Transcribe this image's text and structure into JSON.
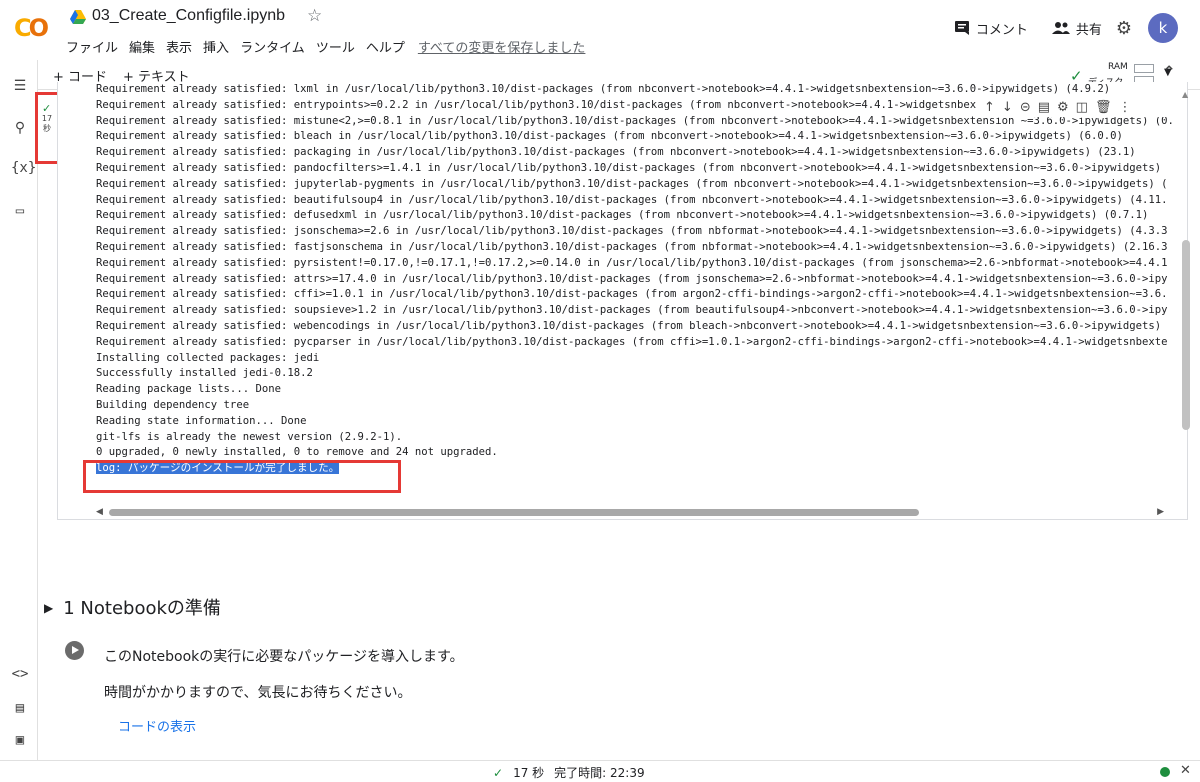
{
  "app": {
    "logo_text": "CO",
    "title": "03_Create_Configfile.ipynb"
  },
  "menu": [
    "ファイル",
    "編集",
    "表示",
    "挿入",
    "ランタイム",
    "ツール",
    "ヘルプ"
  ],
  "saved_status": "すべての変更を保存しました",
  "header": {
    "comment": "コメント",
    "share": "共有",
    "avatar": "k"
  },
  "toolbar": {
    "add_code": "+ コード",
    "add_text": "+ テキスト",
    "ram": "RAM",
    "disk": "ディスク"
  },
  "cell": {
    "exec_time": "17\n秒",
    "output_lines": [
      "Requirement already satisfied: lxml in /usr/local/lib/python3.10/dist-packages (from nbconvert->notebook>=4.4.1->widgetsnbextension~=3.6.0->ipywidgets) (4.9.2)",
      "Requirement already satisfied: entrypoints>=0.2.2 in /usr/local/lib/python3.10/dist-packages (from nbconvert->notebook>=4.4.1->widgetsnbex",
      "Requirement already satisfied: mistune<2,>=0.8.1 in /usr/local/lib/python3.10/dist-packages (from nbconvert->notebook>=4.4.1->widgetsnbextension ~=3.6.0->ipywidgets) (0.",
      "Requirement already satisfied: bleach in /usr/local/lib/python3.10/dist-packages (from nbconvert->notebook>=4.4.1->widgetsnbextension~=3.6.0->ipywidgets) (6.0.0)",
      "Requirement already satisfied: packaging in /usr/local/lib/python3.10/dist-packages (from nbconvert->notebook>=4.4.1->widgetsnbextension~=3.6.0->ipywidgets) (23.1)",
      "Requirement already satisfied: pandocfilters>=1.4.1 in /usr/local/lib/python3.10/dist-packages (from nbconvert->notebook>=4.4.1->widgetsnbextension~=3.6.0->ipywidgets)",
      "Requirement already satisfied: jupyterlab-pygments in /usr/local/lib/python3.10/dist-packages (from nbconvert->notebook>=4.4.1->widgetsnbextension~=3.6.0->ipywidgets) (",
      "Requirement already satisfied: beautifulsoup4 in /usr/local/lib/python3.10/dist-packages (from nbconvert->notebook>=4.4.1->widgetsnbextension~=3.6.0->ipywidgets) (4.11.",
      "Requirement already satisfied: defusedxml in /usr/local/lib/python3.10/dist-packages (from nbconvert->notebook>=4.4.1->widgetsnbextension~=3.6.0->ipywidgets) (0.7.1)",
      "Requirement already satisfied: jsonschema>=2.6 in /usr/local/lib/python3.10/dist-packages (from nbformat->notebook>=4.4.1->widgetsnbextension~=3.6.0->ipywidgets) (4.3.3",
      "Requirement already satisfied: fastjsonschema in /usr/local/lib/python3.10/dist-packages (from nbformat->notebook>=4.4.1->widgetsnbextension~=3.6.0->ipywidgets) (2.16.3",
      "Requirement already satisfied: pyrsistent!=0.17.0,!=0.17.1,!=0.17.2,>=0.14.0 in /usr/local/lib/python3.10/dist-packages (from jsonschema>=2.6->nbformat->notebook>=4.4.1",
      "Requirement already satisfied: attrs>=17.4.0 in /usr/local/lib/python3.10/dist-packages (from jsonschema>=2.6->nbformat->notebook>=4.4.1->widgetsnbextension~=3.6.0->ipy",
      "Requirement already satisfied: cffi>=1.0.1 in /usr/local/lib/python3.10/dist-packages (from argon2-cffi-bindings->argon2-cffi->notebook>=4.4.1->widgetsnbextension~=3.6.",
      "Requirement already satisfied: soupsieve>1.2 in /usr/local/lib/python3.10/dist-packages (from beautifulsoup4->nbconvert->notebook>=4.4.1->widgetsnbextension~=3.6.0->ipy",
      "Requirement already satisfied: webencodings in /usr/local/lib/python3.10/dist-packages (from bleach->nbconvert->notebook>=4.4.1->widgetsnbextension~=3.6.0->ipywidgets)",
      "Requirement already satisfied: pycparser in /usr/local/lib/python3.10/dist-packages (from cffi>=1.0.1->argon2-cffi-bindings->argon2-cffi->notebook>=4.4.1->widgetsnbexte",
      "Installing collected packages: jedi",
      "Successfully installed jedi-0.18.2",
      "Reading package lists... Done",
      "Building dependency tree",
      "Reading state information... Done",
      "git-lfs is already the newest version (2.9.2-1).",
      "0 upgraded, 0 newly installed, 0 to remove and 24 not upgraded."
    ],
    "final_log": "log: パッケージのインストールが完了しました。"
  },
  "section": {
    "title": "1 Notebookの準備"
  },
  "text_cell": {
    "line1": "このNotebookの実行に必要なパッケージを導入します。",
    "line2": "時間がかかりますので、気長にお待ちください。",
    "show_code": "コードの表示"
  },
  "statusbar": {
    "time": "17 秒",
    "completed": "完了時間: 22:39"
  },
  "colors": {
    "accent": "#1a73e8",
    "highlight": "#e53935",
    "ok": "#1e8e3e"
  }
}
